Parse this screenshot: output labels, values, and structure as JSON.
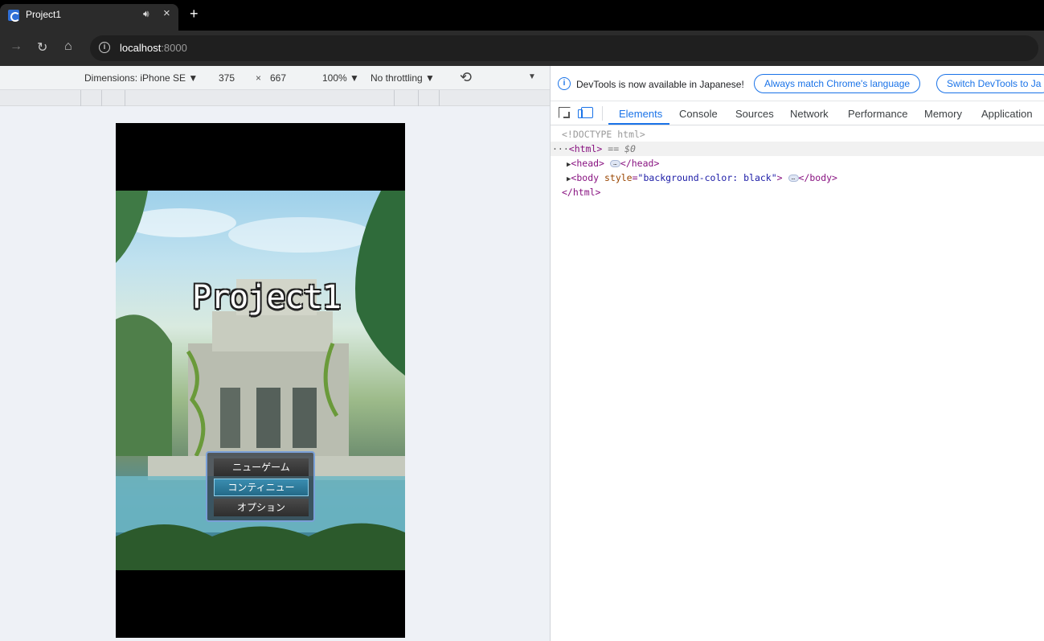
{
  "browser": {
    "tab_title": "Project1",
    "tab_audio_icon": "speaker-icon",
    "tab_close": "×",
    "new_tab": "+",
    "url_host": "localhost",
    "url_port": ":8000"
  },
  "device_toolbar": {
    "dimensions_label": "Dimensions: iPhone SE ▼",
    "width": "375",
    "times": "×",
    "height": "667",
    "zoom": "100% ▼",
    "throttling": "No throttling ▼",
    "rotate_icon": "rotate-icon",
    "more": "▼"
  },
  "game": {
    "title": "Project1",
    "menu": [
      "ニューゲーム",
      "コンティニュー",
      "オプション"
    ],
    "selected_index": 1
  },
  "devtools": {
    "infobar_text": "DevTools is now available in Japanese!",
    "match_language_btn": "Always match Chrome's language",
    "switch_btn": "Switch DevTools to Ja",
    "tabs": [
      "Elements",
      "Console",
      "Sources",
      "Network",
      "Performance",
      "Memory",
      "Application"
    ],
    "active_tab": "Elements",
    "dom": {
      "doctype": "<!DOCTYPE html>",
      "html_open": "<html>",
      "html_selected_marker": "== $0",
      "head_open": "<head>",
      "head_close": "</head>",
      "body_open_tag": "<body",
      "body_attr_name": "style",
      "body_attr_value": "\"background-color: black\"",
      "body_close": "</body>",
      "html_close": "</html>",
      "row_dots": "···"
    }
  },
  "colors": {
    "accent": "#1a73e8",
    "tag": "#881280",
    "attr_name": "#994500",
    "attr_value": "#1a1aa6"
  }
}
